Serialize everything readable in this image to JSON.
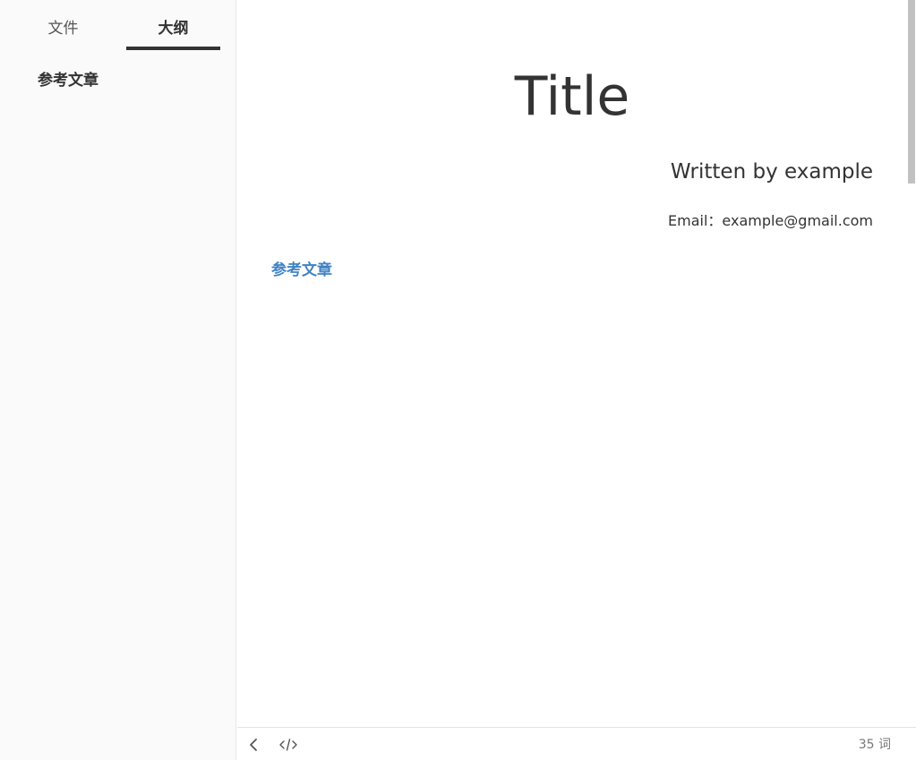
{
  "sidebar": {
    "tabs": [
      {
        "label": "文件",
        "active": false
      },
      {
        "label": "大纲",
        "active": true
      }
    ],
    "outline": [
      {
        "label": "参考文章"
      }
    ]
  },
  "document": {
    "title": "Title",
    "author_line": "Written by example",
    "email_line": "Email：example@gmail.com",
    "headings": [
      {
        "label": "参考文章"
      }
    ]
  },
  "footer": {
    "back_icon": "chevron-left-icon",
    "source_icon": "code-icon",
    "word_count": "35 词"
  },
  "colors": {
    "accent": "#4183c4",
    "text": "#333333",
    "sidebar_bg": "#fafafa"
  }
}
